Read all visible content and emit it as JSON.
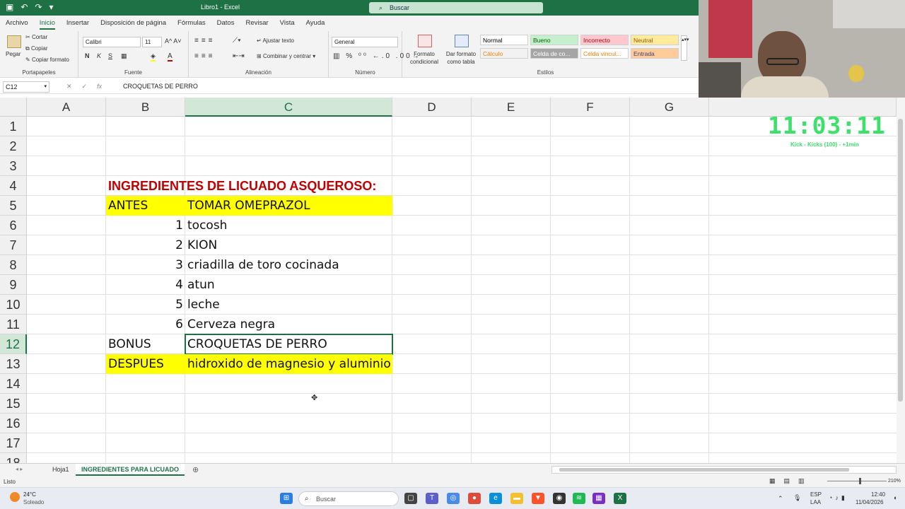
{
  "titlebar": {
    "title": "Libro1 - Excel",
    "search_placeholder": "Buscar"
  },
  "menu": {
    "tabs": [
      "Archivo",
      "Inicio",
      "Insertar",
      "Disposición de página",
      "Fórmulas",
      "Datos",
      "Revisar",
      "Vista",
      "Ayuda"
    ],
    "active": "Inicio"
  },
  "ribbon": {
    "portapapeles": {
      "label": "Portapapeles",
      "paste": "Pegar",
      "cut": "Cortar",
      "copy": "Copiar",
      "format_painter": "Copiar formato"
    },
    "fuente": {
      "label": "Fuente",
      "font": "Calibri",
      "size": "11",
      "bold": "N",
      "italic": "K",
      "underline": "S"
    },
    "alineacion": {
      "label": "Alineación",
      "wrap": "Ajustar texto",
      "merge": "Combinar y centrar"
    },
    "numero": {
      "label": "Número",
      "format": "General"
    },
    "estilos": {
      "label": "Estilos",
      "conditional": "Formato condicional",
      "table": "Dar formato como tabla",
      "styles": [
        {
          "name": "Normal",
          "bg": "#ffffff",
          "fg": "#000000"
        },
        {
          "name": "Bueno",
          "bg": "#c6efce",
          "fg": "#006100"
        },
        {
          "name": "Incorrecto",
          "bg": "#ffc7ce",
          "fg": "#9c0006"
        },
        {
          "name": "Neutral",
          "bg": "#ffeb9c",
          "fg": "#9c5700"
        },
        {
          "name": "Cálculo",
          "bg": "#f2f2f2",
          "fg": "#fa7d00"
        },
        {
          "name": "Celda de co...",
          "bg": "#a5a5a5",
          "fg": "#ffffff"
        },
        {
          "name": "Celda vincul...",
          "bg": "#ffffff",
          "fg": "#fa7d00"
        },
        {
          "name": "Entrada",
          "bg": "#ffcc99",
          "fg": "#3f3f76"
        }
      ]
    }
  },
  "formula_bar": {
    "name_box": "C12",
    "formula": "CROQUETAS DE PERRO"
  },
  "columns": [
    "A",
    "B",
    "C",
    "D",
    "E",
    "F",
    "G"
  ],
  "selected_column": "C",
  "rows": [
    "1",
    "2",
    "3",
    "4",
    "5",
    "6",
    "7",
    "8",
    "9",
    "10",
    "11",
    "12",
    "13",
    "14",
    "15",
    "16",
    "17",
    "18"
  ],
  "selected_row": "12",
  "cells": {
    "title": "INGREDIENTES DE LICUADO ASQUEROSO:",
    "b5": "ANTES",
    "c5": "TOMAR OMEPRAZOL",
    "b6": "1",
    "c6": "tocosh",
    "b7": "2",
    "c7": "KION",
    "b8": "3",
    "c8": "criadilla de toro cocinada",
    "b9": "4",
    "c9": "atun",
    "b10": "5",
    "c10": "leche",
    "b11": "6",
    "c11": "Cerveza negra",
    "b12": "BONUS",
    "c12": "CROQUETAS DE PERRO",
    "b13": "DESPUES",
    "c13": "hidroxido de magnesio y aluminio"
  },
  "colors": {
    "excel_green": "#1e7145",
    "highlight": "#ffff00",
    "title_red": "#c00000",
    "timer_green": "#3ce06a"
  },
  "overlay": {
    "timer": "11:03:11",
    "subtext": "Kick - Kicks (100) - +1min"
  },
  "sheets": [
    "Hoja1",
    "INGREDIENTES PARA LICUADO"
  ],
  "active_sheet": "INGREDIENTES PARA LICUADO",
  "status": {
    "text": "Listo",
    "zoom": "210%"
  },
  "taskbar": {
    "weather_temp": "24°C",
    "weather_desc": "Soleado",
    "search": "Buscar",
    "lang": "ESP",
    "lang2": "LAA",
    "time": "12:40",
    "date": "11/04/2026"
  }
}
